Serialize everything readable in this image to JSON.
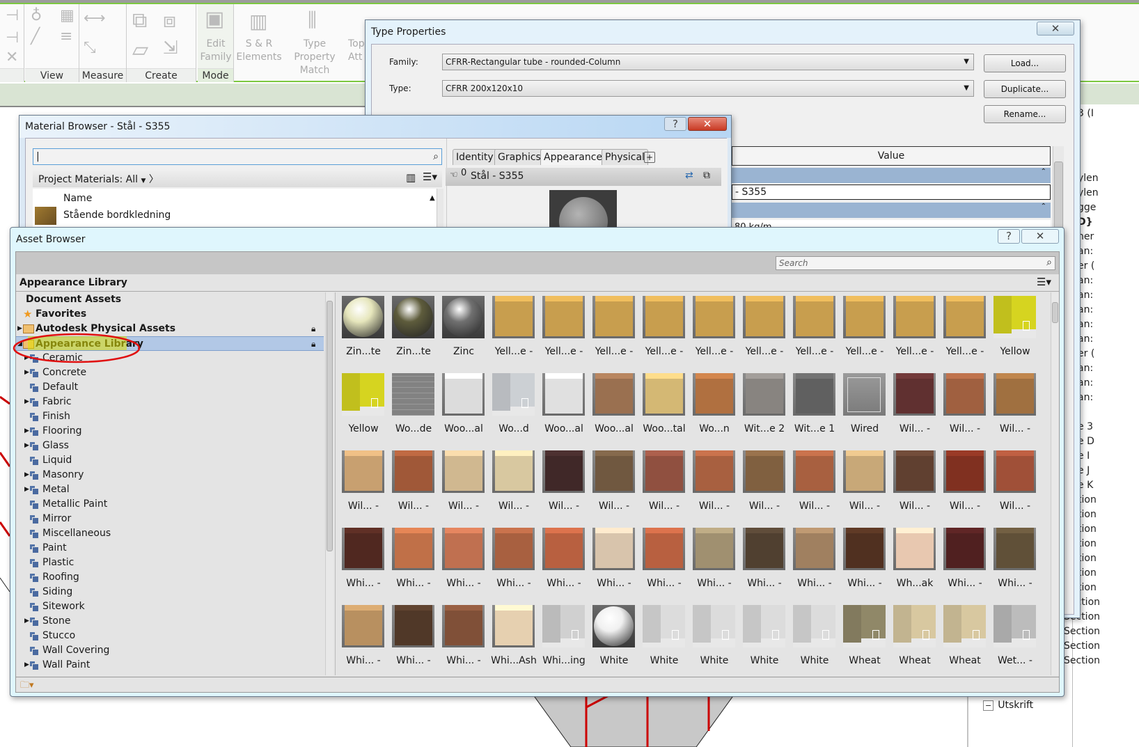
{
  "ribbon": {
    "panels": [
      {
        "label": ""
      },
      {
        "label": "View"
      },
      {
        "label": "Measure"
      },
      {
        "label": "Create"
      },
      {
        "label": "Mode"
      }
    ],
    "buttons": [
      {
        "line1": "Edit",
        "line2": "Family"
      },
      {
        "line1": "S & R",
        "line2": "Elements"
      },
      {
        "line1": "Type Property",
        "line2": "Match"
      },
      {
        "line1": "Top",
        "line2": "Att"
      }
    ]
  },
  "type_properties": {
    "title": "Type Properties",
    "family_label": "Family:",
    "family_value": "CFRR-Rectangular tube - rounded-Column",
    "type_label": "Type:",
    "type_value": "CFRR 200x120x10",
    "load_label": "Load...",
    "duplicate_label": "Duplicate...",
    "rename_label": "Rename...",
    "value_header": "Value",
    "rows": [
      {
        "value": "- S355"
      },
      {
        "value": "80 kg/m"
      }
    ]
  },
  "material_browser": {
    "title": "Material Browser - Stål - S355",
    "search_value": "",
    "filter_label": "Project Materials: All",
    "name_header": "Name",
    "list": [
      {
        "name": "Stående bordkledning"
      }
    ],
    "tabs": [
      "Identity",
      "Graphics",
      "Appearance",
      "Physical"
    ],
    "active_tab": "Appearance",
    "usage_count": "0",
    "asset_name": "Stål - S355"
  },
  "asset_browser": {
    "title": "Asset Browser",
    "search_placeholder": "Search",
    "library_header": "Appearance Library",
    "tree": [
      {
        "label": "Document Assets",
        "bold": true,
        "icon": "none"
      },
      {
        "label": "Favorites",
        "bold": true,
        "icon": "star-icon"
      },
      {
        "label": "Autodesk Physical Assets",
        "bold": true,
        "icon": "folder-icon",
        "expandable": true,
        "locked": true
      },
      {
        "label": "Appearance Library",
        "bold": true,
        "icon": "folder-icon",
        "expanded": true,
        "locked": true,
        "selected": true
      },
      {
        "label": "Ceramic",
        "expandable": true
      },
      {
        "label": "Concrete",
        "expandable": true
      },
      {
        "label": "Default"
      },
      {
        "label": "Fabric",
        "expandable": true
      },
      {
        "label": "Finish"
      },
      {
        "label": "Flooring",
        "expandable": true
      },
      {
        "label": "Glass",
        "expandable": true
      },
      {
        "label": "Liquid"
      },
      {
        "label": "Masonry",
        "expandable": true
      },
      {
        "label": "Metal",
        "expandable": true
      },
      {
        "label": "Metallic Paint"
      },
      {
        "label": "Mirror"
      },
      {
        "label": "Miscellaneous"
      },
      {
        "label": "Paint"
      },
      {
        "label": "Plastic"
      },
      {
        "label": "Roofing"
      },
      {
        "label": "Siding"
      },
      {
        "label": "Sitework"
      },
      {
        "label": "Stone",
        "expandable": true
      },
      {
        "label": "Stucco"
      },
      {
        "label": "Wall Covering"
      },
      {
        "label": "Wall Paint",
        "expandable": true
      }
    ],
    "tiles": [
      [
        {
          "label": "Zin...te",
          "kind": "sphere",
          "color": "#e6e6bc"
        },
        {
          "label": "Zin...te",
          "kind": "sphere",
          "color": "#5e5c3c"
        },
        {
          "label": "Zinc",
          "kind": "sphere",
          "color": "#707070"
        },
        {
          "label": "Yell...e -",
          "kind": "cube",
          "color": "#c89e4e"
        },
        {
          "label": "Yell...e -",
          "kind": "cube",
          "color": "#c89e4e"
        },
        {
          "label": "Yell...e -",
          "kind": "cube",
          "color": "#c89e4e"
        },
        {
          "label": "Yell...e -",
          "kind": "cube",
          "color": "#c89e4e"
        },
        {
          "label": "Yell...e -",
          "kind": "cube",
          "color": "#c89e4e"
        },
        {
          "label": "Yell...e -",
          "kind": "cube",
          "color": "#c89e4e"
        },
        {
          "label": "Yell...e -",
          "kind": "cube",
          "color": "#c89e4e"
        },
        {
          "label": "Yell...e -",
          "kind": "cube",
          "color": "#c89e4e"
        },
        {
          "label": "Yell...e -",
          "kind": "cube",
          "color": "#c89e4e"
        },
        {
          "label": "Yell...e -",
          "kind": "cube",
          "color": "#c89e4e"
        },
        {
          "label": "Yellow",
          "kind": "wall",
          "color": "#d6d420"
        }
      ],
      [
        {
          "label": "Yellow",
          "kind": "wall",
          "color": "#d6d420"
        },
        {
          "label": "Wo...de",
          "kind": "wire",
          "color": "#b8b8b8"
        },
        {
          "label": "Woo...al",
          "kind": "cube",
          "color": "#dcdcdc"
        },
        {
          "label": "Wo...d",
          "kind": "wall",
          "color": "#ccd0d4"
        },
        {
          "label": "Woo...al",
          "kind": "cube",
          "color": "#e0e0e0"
        },
        {
          "label": "Woo...al",
          "kind": "cube",
          "color": "#9a7050"
        },
        {
          "label": "Woo...tal",
          "kind": "cube",
          "color": "#d4b874"
        },
        {
          "label": "Wo...n",
          "kind": "cube",
          "color": "#b07040"
        },
        {
          "label": "Wit...e 2",
          "kind": "cube",
          "color": "#888480"
        },
        {
          "label": "Wit...e 1",
          "kind": "cube",
          "color": "#606060"
        },
        {
          "label": "Wired",
          "kind": "glass",
          "color": "#a8a8a8"
        },
        {
          "label": "Wil... -",
          "kind": "cube",
          "color": "#603030"
        },
        {
          "label": "Wil... -",
          "kind": "cube",
          "color": "#a06040"
        },
        {
          "label": "Wil... -",
          "kind": "cube",
          "color": "#a07040"
        }
      ],
      [
        {
          "label": "Wil... -",
          "kind": "cube",
          "color": "#c8a070"
        },
        {
          "label": "Wil... -",
          "kind": "cube",
          "color": "#a05838"
        },
        {
          "label": "Wil... -",
          "kind": "cube",
          "color": "#d0b890"
        },
        {
          "label": "Wil... -",
          "kind": "cube",
          "color": "#d8c8a0"
        },
        {
          "label": "Wil... -",
          "kind": "cube",
          "color": "#402828"
        },
        {
          "label": "Wil... -",
          "kind": "cube",
          "color": "#705840"
        },
        {
          "label": "Wil... -",
          "kind": "cube",
          "color": "#905040"
        },
        {
          "label": "Wil... -",
          "kind": "cube",
          "color": "#a86040"
        },
        {
          "label": "Wil... -",
          "kind": "cube",
          "color": "#806040"
        },
        {
          "label": "Wil... -",
          "kind": "cube",
          "color": "#a86040"
        },
        {
          "label": "Wil... -",
          "kind": "cube",
          "color": "#c8a878"
        },
        {
          "label": "Wil... -",
          "kind": "cube",
          "color": "#604030"
        },
        {
          "label": "Wil... -",
          "kind": "cube",
          "color": "#803020"
        },
        {
          "label": "Wil... -",
          "kind": "cube",
          "color": "#a05038"
        }
      ],
      [
        {
          "label": "Whi... -",
          "kind": "cube",
          "color": "#502820"
        },
        {
          "label": "Whi... -",
          "kind": "cube",
          "color": "#c07048"
        },
        {
          "label": "Whi... -",
          "kind": "cube",
          "color": "#c07050"
        },
        {
          "label": "Whi... -",
          "kind": "cube",
          "color": "#a86040"
        },
        {
          "label": "Whi... -",
          "kind": "cube",
          "color": "#b86040"
        },
        {
          "label": "Whi... -",
          "kind": "cube",
          "color": "#d8c4ac"
        },
        {
          "label": "Whi... -",
          "kind": "cube",
          "color": "#b86040"
        },
        {
          "label": "Whi... -",
          "kind": "cube",
          "color": "#a09070"
        },
        {
          "label": "Whi... -",
          "kind": "cube",
          "color": "#504030"
        },
        {
          "label": "Whi... -",
          "kind": "cube",
          "color": "#a08060"
        },
        {
          "label": "Whi... -",
          "kind": "cube",
          "color": "#503020"
        },
        {
          "label": "Wh...ak",
          "kind": "cube",
          "color": "#e8c8b0"
        },
        {
          "label": "Whi... -",
          "kind": "cube",
          "color": "#502020"
        },
        {
          "label": "Whi... -",
          "kind": "cube",
          "color": "#605038"
        }
      ],
      [
        {
          "label": "Whi... -",
          "kind": "cube",
          "color": "#b89060"
        },
        {
          "label": "Whi... -",
          "kind": "cube",
          "color": "#503828"
        },
        {
          "label": "Whi... -",
          "kind": "cube",
          "color": "#805038"
        },
        {
          "label": "Whi...Ash",
          "kind": "cube",
          "color": "#e6d0b0"
        },
        {
          "label": "Whi...ing",
          "kind": "wall",
          "color": "#d0d0d0"
        },
        {
          "label": "White",
          "kind": "sphere",
          "color": "#f0f0f0"
        },
        {
          "label": "White",
          "kind": "wall",
          "color": "#dcdcdc"
        },
        {
          "label": "White",
          "kind": "wall",
          "color": "#dcdcdc"
        },
        {
          "label": "White",
          "kind": "wall",
          "color": "#dcdcdc"
        },
        {
          "label": "White",
          "kind": "wall",
          "color": "#dcdcdc"
        },
        {
          "label": "Wheat",
          "kind": "wall",
          "color": "#908868"
        },
        {
          "label": "Wheat",
          "kind": "wall",
          "color": "#d8c8a0"
        },
        {
          "label": "Wheat",
          "kind": "wall",
          "color": "#d8c8a0"
        },
        {
          "label": "Wet... -",
          "kind": "wall",
          "color": "#bcbcbc"
        }
      ]
    ]
  },
  "project_browser": {
    "fragments": [
      "3 (I",
      "ylen",
      "ylen",
      "gge",
      "D}",
      "ner",
      "an:",
      "er (",
      "an:",
      "an:",
      "an:",
      "an:",
      "an:",
      "er (",
      "an:",
      "an:",
      "an:",
      "",
      "e 3",
      "e D",
      "e I",
      "e J",
      "e K",
      "tion",
      "tion",
      "tion",
      "tion",
      "tion",
      "tion",
      "tion",
      "Section",
      "Section",
      "Section",
      "Section",
      "Section"
    ],
    "bottom_item": "Utskrift"
  },
  "colors": {
    "selection": "#b2c8e6",
    "annotation_circle": "#e01010",
    "annotation_highlight": "#e0e000",
    "ribbon_accent": "#7cc840"
  }
}
